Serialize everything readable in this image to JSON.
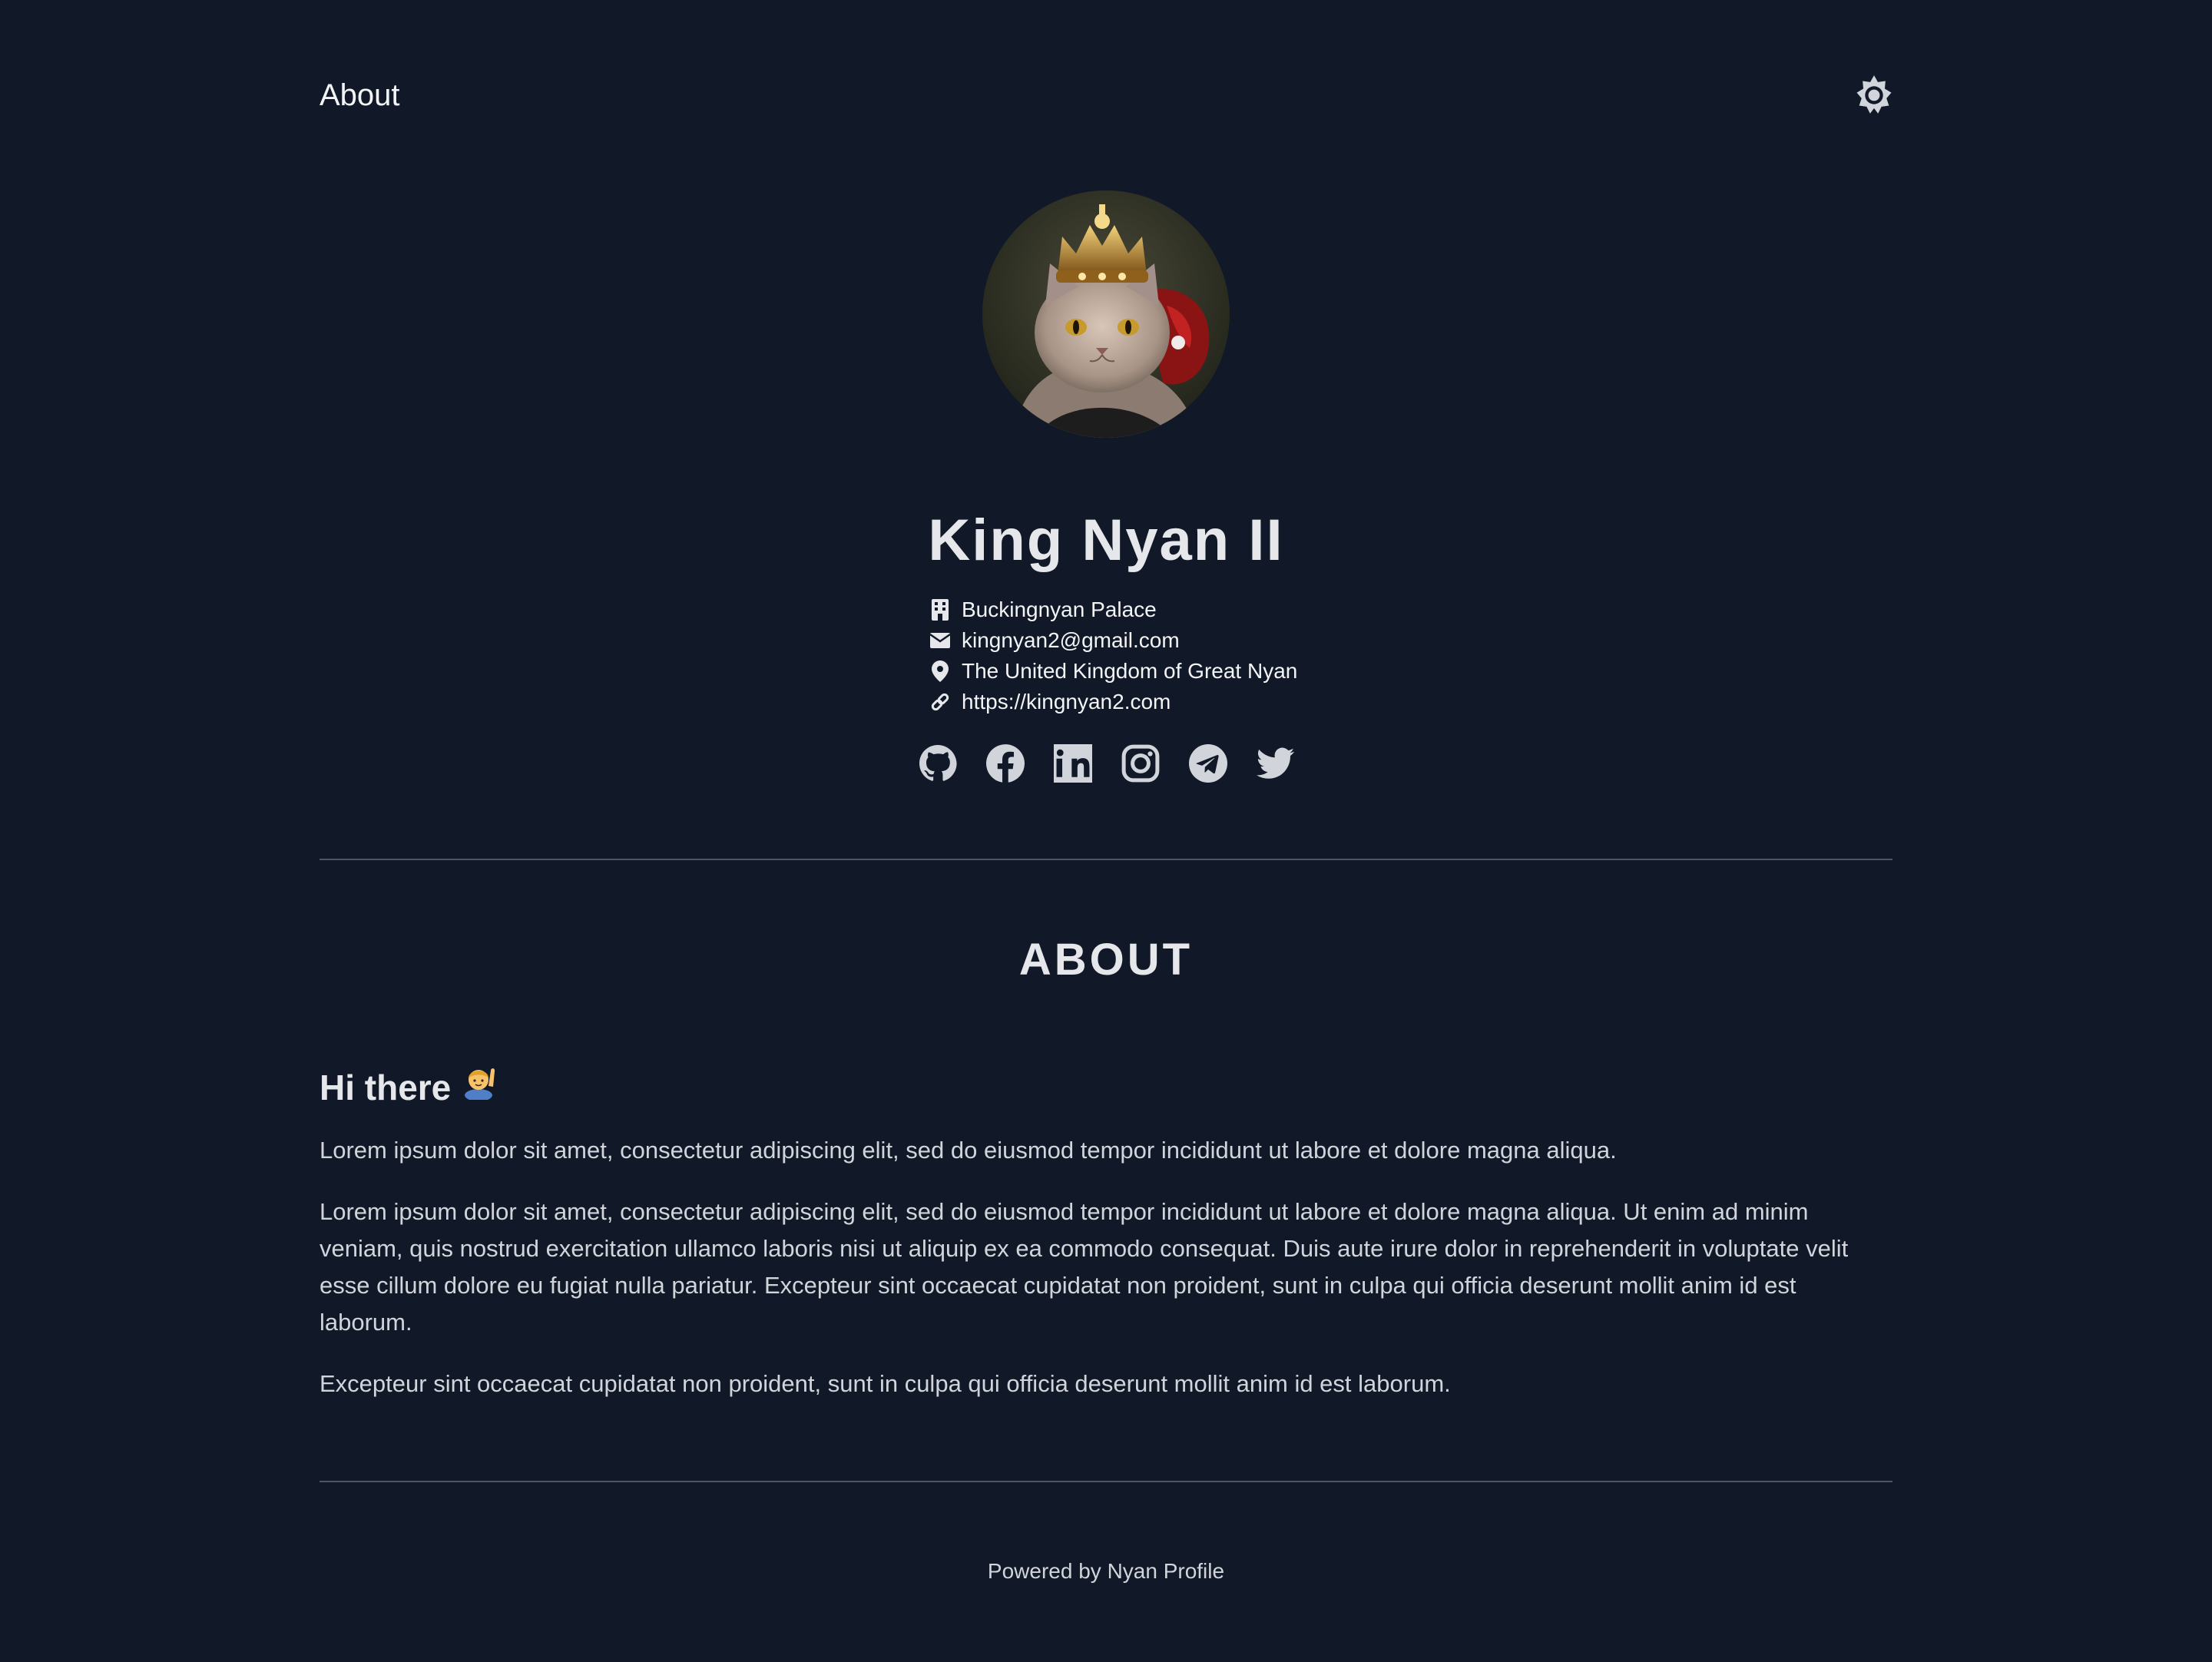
{
  "nav": {
    "title": "About",
    "theme_toggle_icon": "sun-icon"
  },
  "profile": {
    "avatar_alt": "King Nyan II avatar",
    "name": "King Nyan II",
    "info": [
      {
        "icon": "building-icon",
        "text": "Buckingnyan Palace"
      },
      {
        "icon": "mail-icon",
        "text": "kingnyan2@gmail.com"
      },
      {
        "icon": "location-pin-icon",
        "text": "The United Kingdom of Great Nyan"
      },
      {
        "icon": "link-icon",
        "text": "https://kingnyan2.com"
      }
    ],
    "social": [
      "github-icon",
      "facebook-icon",
      "linkedin-icon",
      "instagram-icon",
      "telegram-icon",
      "twitter-icon"
    ]
  },
  "about": {
    "section_title": "ABOUT",
    "heading": "Hi there",
    "heading_emoji": "waving-person-emoji",
    "paragraphs": [
      "Lorem ipsum dolor sit amet, consectetur adipiscing elit, sed do eiusmod tempor incididunt ut labore et dolore magna aliqua.",
      "Lorem ipsum dolor sit amet, consectetur adipiscing elit, sed do eiusmod tempor incididunt ut labore et dolore magna aliqua. Ut enim ad minim veniam, quis nostrud exercitation ullamco laboris nisi ut aliquip ex ea commodo consequat. Duis aute irure dolor in reprehenderit in voluptate velit esse cillum dolore eu fugiat nulla pariatur. Excepteur sint occaecat cupidatat non proident, sunt in culpa qui officia deserunt mollit anim id est laborum.",
      "Excepteur sint occaecat cupidatat non proident, sunt in culpa qui officia deserunt mollit anim id est laborum."
    ]
  },
  "footer": {
    "text": "Powered by Nyan Profile"
  },
  "colors": {
    "background": "#111827",
    "text": "#e5e7eb",
    "divider": "#4b5563",
    "icon": "#d1d5db"
  }
}
